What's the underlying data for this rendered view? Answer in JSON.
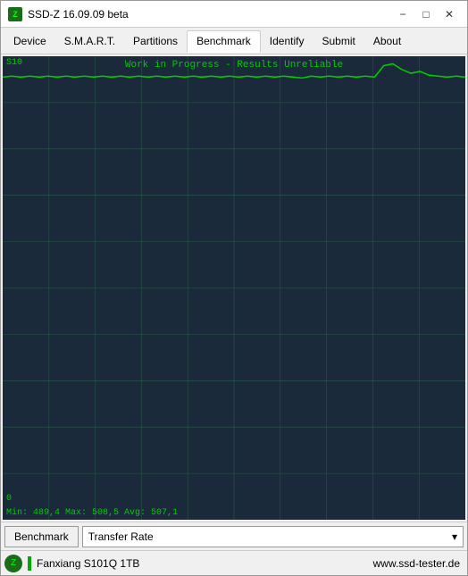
{
  "titleBar": {
    "icon": "Z",
    "title": "SSD-Z 16.09.09 beta",
    "minimize": "−",
    "maximize": "□",
    "close": "✕"
  },
  "menuBar": {
    "items": [
      {
        "label": "Device",
        "active": false
      },
      {
        "label": "S.M.A.R.T.",
        "active": false
      },
      {
        "label": "Partitions",
        "active": false
      },
      {
        "label": "Benchmark",
        "active": true
      },
      {
        "label": "Identify",
        "active": false
      },
      {
        "label": "Submit",
        "active": false
      },
      {
        "label": "About",
        "active": false
      }
    ]
  },
  "chart": {
    "yAxisTop": "S10",
    "yAxisBottom": "0",
    "titleText": "Work in Progress - Results Unreliable",
    "statsText": "Min: 489,4  Max: 508,5  Avg: 507,1"
  },
  "bottomBar": {
    "benchmarkLabel": "Benchmark",
    "dropdownValue": "Transfer Rate",
    "dropdownIcon": "▾"
  },
  "statusBar": {
    "driveName": "Fanxiang S101Q 1TB",
    "url": "www.ssd-tester.de"
  }
}
